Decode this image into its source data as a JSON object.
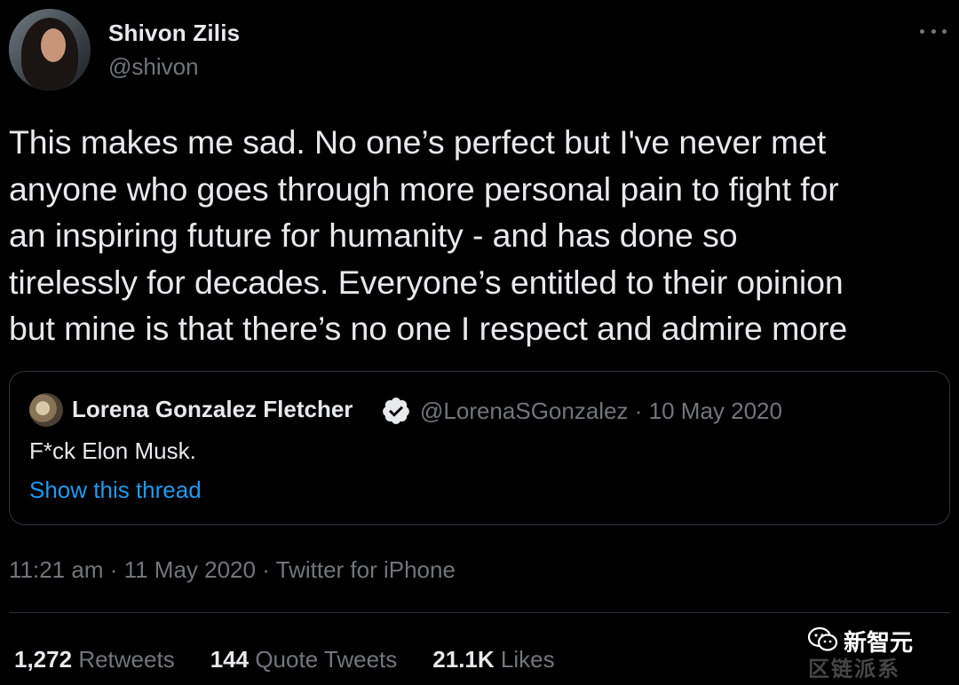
{
  "author": {
    "name": "Shivon Zilis",
    "handle": "@shivon"
  },
  "tweet": {
    "lines": [
      "This makes me sad. No one’s perfect but I've never met",
      "anyone who goes through more personal pain to fight for",
      "an inspiring future for humanity - and has done so",
      "tirelessly for decades. Everyone’s entitled to their opinion",
      "but mine is that there’s no one I respect and admire more"
    ]
  },
  "quote": {
    "name": "Lorena Gonzalez Fletcher",
    "meta": "@LorenaSGonzalez · 10 May 2020",
    "text": "F*ck Elon Musk.",
    "show_thread": "Show this thread"
  },
  "timestamp": {
    "time_date": "11:21 am · 11 May 2020 · ",
    "source": "Twitter for iPhone"
  },
  "stats": {
    "retweets_count": "1,272",
    "retweets_label": "Retweets",
    "quotes_count": "144",
    "quotes_label": "Quote Tweets",
    "likes_count": "21.1K",
    "likes_label": "Likes"
  },
  "watermark": {
    "text": "新智元",
    "sub": "区链派系"
  },
  "colors": {
    "background": "#000000",
    "text_primary": "#e7e9ea",
    "text_secondary": "#71767b",
    "link": "#1d9bf0",
    "border": "#2f3336"
  },
  "icons": {
    "more": "more-horizontal-icon",
    "verified": "verified-badge-icon",
    "wechat": "wechat-icon"
  }
}
